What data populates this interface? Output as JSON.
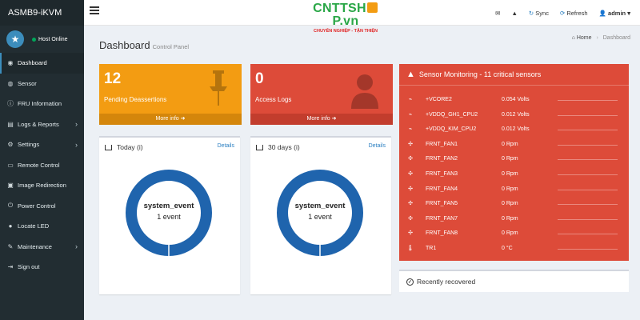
{
  "brand": "ASMB9-iKVM",
  "user_status": "Host Online",
  "sidebar": {
    "items": [
      {
        "label": "Dashboard",
        "icon": "dashboard-icon",
        "glyph": "◉",
        "chevron": false,
        "active": true
      },
      {
        "label": "Sensor",
        "icon": "sensor-icon",
        "glyph": "◍",
        "chevron": false
      },
      {
        "label": "FRU Information",
        "icon": "info-icon",
        "glyph": "ⓘ",
        "chevron": false
      },
      {
        "label": "Logs & Reports",
        "icon": "chart-icon",
        "glyph": "▤",
        "chevron": true
      },
      {
        "label": "Settings",
        "icon": "gear-icon",
        "glyph": "⚙",
        "chevron": true
      },
      {
        "label": "Remote Control",
        "icon": "desktop-icon",
        "glyph": "▭",
        "chevron": false
      },
      {
        "label": "Image Redirection",
        "icon": "image-icon",
        "glyph": "▣",
        "chevron": false
      },
      {
        "label": "Power Control",
        "icon": "power-icon",
        "glyph": "⏻",
        "chevron": false
      },
      {
        "label": "Locate LED",
        "icon": "marker-icon",
        "glyph": "●",
        "chevron": false
      },
      {
        "label": "Maintenance",
        "icon": "wrench-icon",
        "glyph": "✎",
        "chevron": true
      },
      {
        "label": "Sign out",
        "icon": "signout-icon",
        "glyph": "⇥",
        "chevron": false
      }
    ]
  },
  "logo": {
    "main_pre": "CNTTSH",
    "main_post": "P.vn",
    "tagline": "CHUYÊN NGHIỆP - TẬN THIỆN"
  },
  "topbar": {
    "sync": "Sync",
    "refresh": "Refresh",
    "user": "admin"
  },
  "page": {
    "title": "Dashboard",
    "subtitle": "Control Panel"
  },
  "breadcrumb": {
    "home": "Home",
    "current": "Dashboard"
  },
  "boxes": {
    "pending": {
      "value": "12",
      "label": "Pending Deassertions",
      "more": "More info"
    },
    "access": {
      "value": "0",
      "label": "Access Logs",
      "more": "More info"
    }
  },
  "panels": {
    "today": {
      "title": "Today (i)",
      "details": "Details",
      "event": "system_event",
      "count": "1 event",
      "fraction": 1.0
    },
    "days30": {
      "title": "30 days (i)",
      "details": "Details",
      "event": "system_event",
      "count": "1 event",
      "fraction": 1.0
    }
  },
  "sensor": {
    "title": "Sensor Monitoring - 11 critical sensors",
    "rows": [
      {
        "name": "+VCORE2",
        "value": "0.054 Volts",
        "icon": "voltage-icon"
      },
      {
        "name": "+VDDQ_GH1_CPU2",
        "value": "0.012 Volts",
        "icon": "voltage-icon"
      },
      {
        "name": "+VDDQ_KIM_CPU2",
        "value": "0.012 Volts",
        "icon": "voltage-icon"
      },
      {
        "name": "FRNT_FAN1",
        "value": "0 Rpm",
        "icon": "fan-icon"
      },
      {
        "name": "FRNT_FAN2",
        "value": "0 Rpm",
        "icon": "fan-icon"
      },
      {
        "name": "FRNT_FAN3",
        "value": "0 Rpm",
        "icon": "fan-icon"
      },
      {
        "name": "FRNT_FAN4",
        "value": "0 Rpm",
        "icon": "fan-icon"
      },
      {
        "name": "FRNT_FAN5",
        "value": "0 Rpm",
        "icon": "fan-icon"
      },
      {
        "name": "FRNT_FAN7",
        "value": "0 Rpm",
        "icon": "fan-icon"
      },
      {
        "name": "FRNT_FAN8",
        "value": "0 Rpm",
        "icon": "fan-icon"
      },
      {
        "name": "TR1",
        "value": "0 °C",
        "icon": "thermometer-icon"
      }
    ]
  },
  "recovered": "Recently recovered",
  "colors": {
    "sidebar": "#222d32",
    "accent": "#3c8dbc",
    "orange": "#f39c12",
    "red": "#dd4b39",
    "donut": "#1f64ad",
    "link": "#2a7fc1"
  }
}
